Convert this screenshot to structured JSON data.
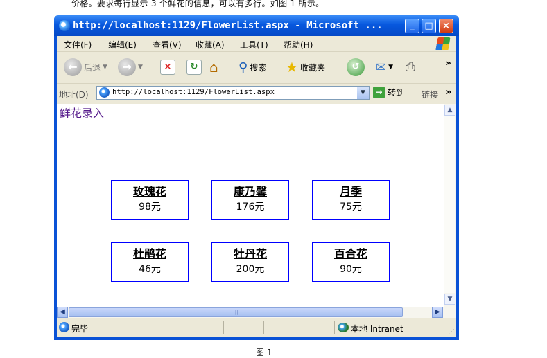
{
  "doc": {
    "caption_top": "价格。要求每行显示 3 个鲜花的信息，可以有多行。如图 1 所示。",
    "caption_bottom": "图 1"
  },
  "window": {
    "title": "http://localhost:1129/FlowerList.aspx - Microsoft ...",
    "controls": {
      "minimize": "_",
      "maximize": "□",
      "close": "×"
    }
  },
  "menu": [
    {
      "label": "文件(F)"
    },
    {
      "label": "编辑(E)"
    },
    {
      "label": "查看(V)"
    },
    {
      "label": "收藏(A)"
    },
    {
      "label": "工具(T)"
    },
    {
      "label": "帮助(H)"
    }
  ],
  "toolbar": {
    "back_label": "后退",
    "search_label": "搜索",
    "favorites_label": "收藏夹",
    "overflow": "»"
  },
  "address": {
    "label": "地址(D)",
    "url": "http://localhost:1129/FlowerList.aspx",
    "go_label": "转到",
    "links_label": "链接",
    "links_overflow": "»"
  },
  "page": {
    "entry_link": "鲜花录入",
    "flowers": [
      {
        "name": "玫瑰花",
        "price": "98元"
      },
      {
        "name": "康乃馨",
        "price": "176元"
      },
      {
        "name": "月季",
        "price": "75元"
      },
      {
        "name": "杜鹃花",
        "price": "46元"
      },
      {
        "name": "牡丹花",
        "price": "200元"
      },
      {
        "name": "百合花",
        "price": "90元"
      }
    ]
  },
  "status": {
    "text": "完毕",
    "zone": "本地 Intranet"
  }
}
